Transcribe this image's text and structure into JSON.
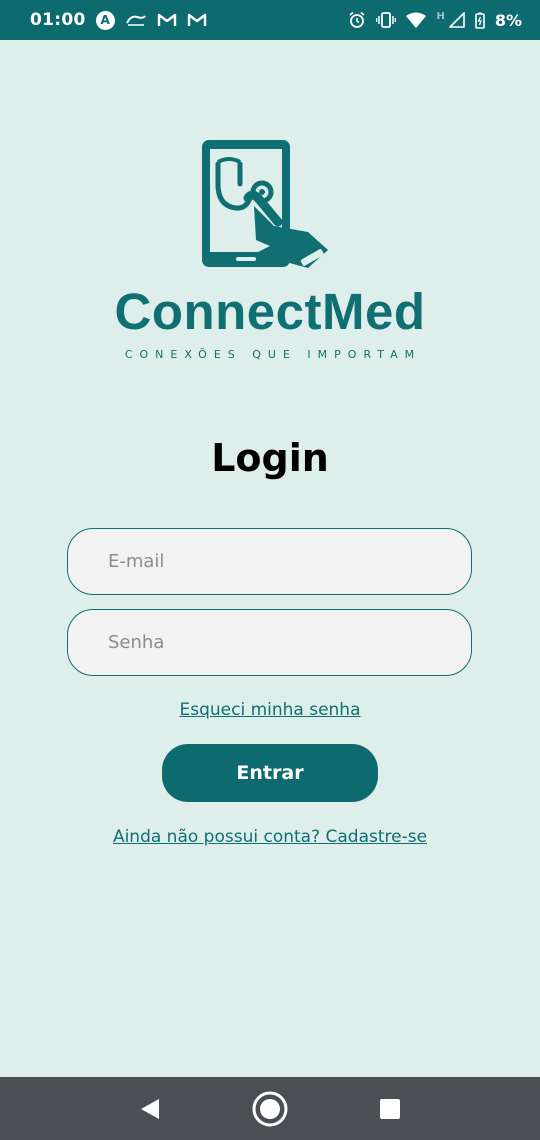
{
  "status_bar": {
    "time": "01:00",
    "battery_percent": "8%",
    "h_indicator": "H",
    "app_icons": [
      "anatel-a-icon",
      "ifood-icon",
      "gmail-icon",
      "gmail-icon"
    ],
    "system_icons": [
      "alarm-icon",
      "vibrate-icon",
      "wifi-icon",
      "signal-icon",
      "battery-icon"
    ],
    "colors": {
      "background": "#0d6b6f",
      "text": "#ffffff"
    }
  },
  "brand": {
    "name": "ConnectMed",
    "tagline": "CONEXÕES QUE IMPORTAM",
    "color": "#106f72"
  },
  "login": {
    "title": "Login",
    "email_placeholder": "E-mail",
    "password_placeholder": "Senha",
    "forgot_password": "Esqueci minha senha",
    "submit_label": "Entrar",
    "signup_link": "Ainda não possui conta? Cadastre-se"
  },
  "colors": {
    "page_background": "#deeeeb",
    "accent": "#0d6b6f",
    "field_background": "#f2f2f2"
  },
  "nav_bar": {
    "buttons": [
      "back-icon",
      "home-icon",
      "recents-icon"
    ],
    "background": "#4b4f54"
  }
}
